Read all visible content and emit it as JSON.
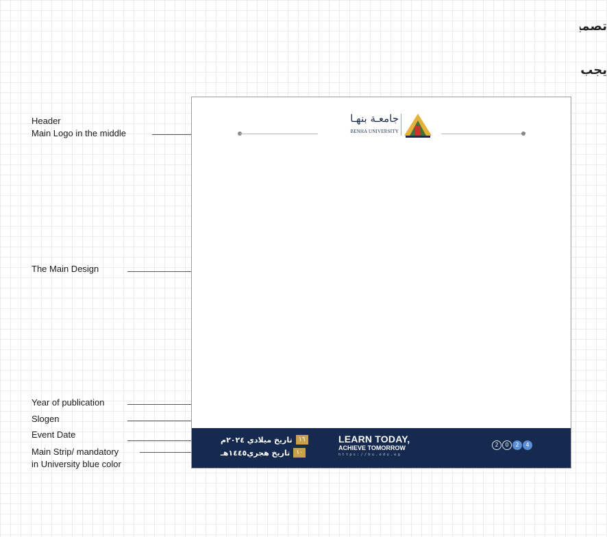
{
  "heading": {
    "line1": "تصميم المنشور الأساسي للتواصل الإجتماعي يحتوي على",
    "line2": "يجب أن يحتوي المنشور على"
  },
  "labels": {
    "header": "Header",
    "header_sub": "Main Logo in the middle",
    "main_design": "The Main Design",
    "year": "Year of publication",
    "slogan": "Slogen",
    "event_date": "Event Date",
    "strip": "Main Strip/ mandatory",
    "strip_sub": "in University blue color"
  },
  "logo": {
    "arabic": "جامعـة بنهـا",
    "english": "BENHA UNIVERSITY"
  },
  "strip": {
    "color": "#16294e",
    "gregorian_day": "١٦",
    "gregorian_text": "تاريخ ميلادي ٢٠٢٤م",
    "hijri_day": "١٠",
    "hijri_text": "تاريخ هجري١٤٤٥هـ",
    "slogan_line1": "LEARN TODAY,",
    "slogan_line2": "ACHIEVE TOMORROW",
    "url": "https://bu.edu.eg",
    "year_digits": [
      "2",
      "0",
      "2",
      "4"
    ]
  }
}
